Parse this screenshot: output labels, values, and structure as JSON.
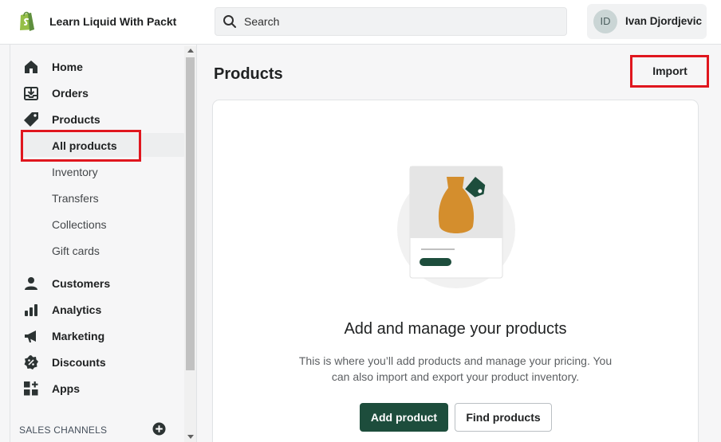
{
  "topbar": {
    "store_name": "Learn Liquid With Packt",
    "search_placeholder": "Search",
    "user_initials": "ID",
    "user_name": "Ivan Djordjevic"
  },
  "sidebar": {
    "items": [
      {
        "label": "Home",
        "icon": "home-icon"
      },
      {
        "label": "Orders",
        "icon": "orders-icon"
      },
      {
        "label": "Products",
        "icon": "tag-icon"
      }
    ],
    "product_sub_items": [
      {
        "label": "All products",
        "active": true
      },
      {
        "label": "Inventory"
      },
      {
        "label": "Transfers"
      },
      {
        "label": "Collections"
      },
      {
        "label": "Gift cards"
      }
    ],
    "items2": [
      {
        "label": "Customers",
        "icon": "customer-icon"
      },
      {
        "label": "Analytics",
        "icon": "analytics-icon"
      },
      {
        "label": "Marketing",
        "icon": "megaphone-icon"
      },
      {
        "label": "Discounts",
        "icon": "discount-icon"
      },
      {
        "label": "Apps",
        "icon": "apps-icon"
      }
    ],
    "sales_channels_label": "SALES CHANNELS"
  },
  "main": {
    "title": "Products",
    "import_label": "Import",
    "empty_state": {
      "title": "Add and manage your products",
      "description": "This is where you’ll add products and manage your pricing. You can also import and export your product inventory.",
      "primary_action": "Add product",
      "secondary_action": "Find products"
    }
  },
  "colors": {
    "primary": "#1d4d3c",
    "highlight": "#e0161e",
    "vase": "#d48e2d"
  }
}
